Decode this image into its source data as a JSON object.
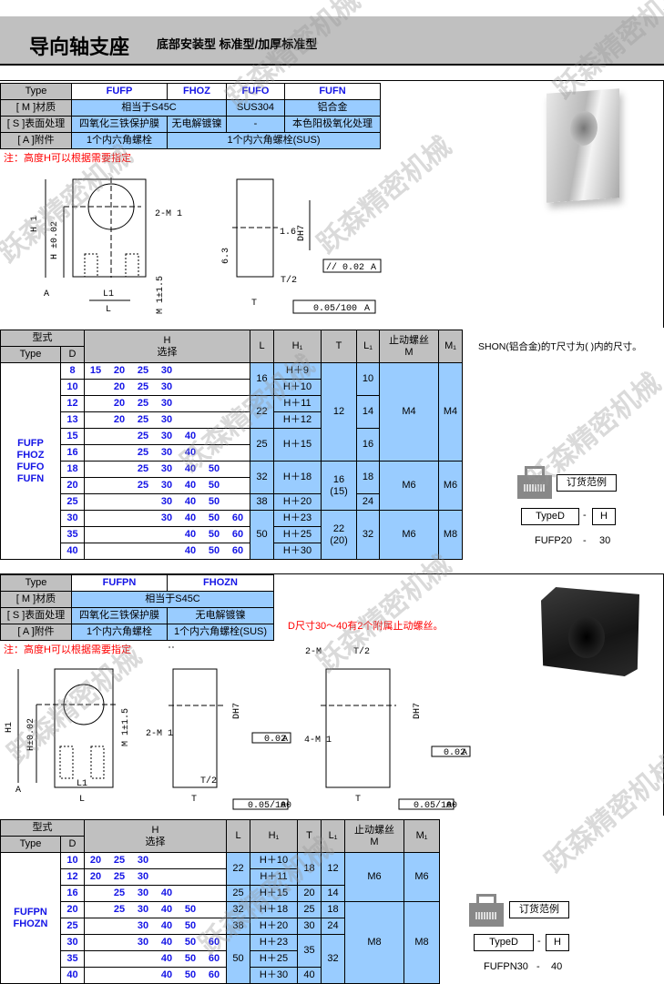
{
  "header": {
    "title": "导向轴支座",
    "subtitle": "底部安装型 标准型/加厚标准型"
  },
  "watermark": "跃森精密机械",
  "colors": {
    "header_gray": "#c0c0c0",
    "cell_blue": "#99ccff",
    "type_text": "#1414e6",
    "note_red": "#ff0000"
  },
  "spec1": {
    "type_label": "Type",
    "types": [
      "FUFP",
      "FHOZ",
      "FUFO",
      "FUFN"
    ],
    "material_label": "[ M ]材质",
    "material": [
      "相当于S45C",
      "SUS304",
      "铝合金"
    ],
    "surface_label": "[ S ]表面处理",
    "surface": [
      "四氧化三铁保护膜",
      "无电解镀镍",
      "-",
      "本色阳极氧化处理"
    ],
    "accessory_label": "[ A ]附件",
    "accessory": [
      "1个内六角螺栓",
      "1个内六角螺栓(SUS)"
    ],
    "note": "注：高度H可以根据需要指定"
  },
  "drawing1": {
    "M": "M",
    "M1": "2-M 1",
    "H1": "H 1",
    "H": "H ±0.02",
    "L1": "L1",
    "L": "L",
    "M1h": "M 1±1.5",
    "DH7": "DH7",
    "r16": "1.6",
    "r63": "6.3",
    "T2": "T/2",
    "T": "T",
    "par1": "0.02",
    "par2": "0.05/100",
    "datum": "A",
    "par_sym": "//"
  },
  "table1": {
    "h_type_cn": "型式",
    "h_type": "Type",
    "h_D": "D",
    "h_H": "H\n选择",
    "h_L": "L",
    "h_H1": "H₁",
    "h_T": "T",
    "h_L1": "L₁",
    "h_M": "止动螺丝\nM",
    "h_M1": "M₁",
    "types": "FUFP\nFHOZ\nFUFO\nFUFN",
    "rows": [
      {
        "D": "8",
        "H": [
          "15",
          "20",
          "25",
          "30",
          "",
          "",
          ""
        ]
      },
      {
        "D": "10",
        "H": [
          "",
          "20",
          "25",
          "30",
          "",
          "",
          ""
        ]
      },
      {
        "D": "12",
        "H": [
          "",
          "20",
          "25",
          "30",
          "",
          "",
          ""
        ]
      },
      {
        "D": "13",
        "H": [
          "",
          "20",
          "25",
          "30",
          "",
          "",
          ""
        ]
      },
      {
        "D": "15",
        "H": [
          "",
          "",
          "25",
          "30",
          "40",
          "",
          ""
        ]
      },
      {
        "D": "16",
        "H": [
          "",
          "",
          "25",
          "30",
          "40",
          "",
          ""
        ]
      },
      {
        "D": "18",
        "H": [
          "",
          "",
          "25",
          "30",
          "40",
          "50",
          ""
        ]
      },
      {
        "D": "20",
        "H": [
          "",
          "",
          "25",
          "30",
          "40",
          "50",
          ""
        ]
      },
      {
        "D": "25",
        "H": [
          "",
          "",
          "",
          "30",
          "40",
          "50",
          ""
        ]
      },
      {
        "D": "30",
        "H": [
          "",
          "",
          "",
          "30",
          "40",
          "50",
          "60"
        ]
      },
      {
        "D": "35",
        "H": [
          "",
          "",
          "",
          "",
          "40",
          "50",
          "60"
        ]
      },
      {
        "D": "40",
        "H": [
          "",
          "",
          "",
          "",
          "40",
          "50",
          "60"
        ]
      }
    ],
    "L": [
      {
        "v": "16",
        "span": 2
      },
      {
        "v": "22",
        "span": 2
      },
      {
        "v": "25",
        "span": 2
      },
      {
        "v": "32",
        "span": 2
      },
      {
        "v": "38",
        "span": 1
      },
      {
        "v": "50",
        "span": 3
      }
    ],
    "H1": [
      {
        "v": "H＋9",
        "span": 1
      },
      {
        "v": "H＋10",
        "span": 1
      },
      {
        "v": "H＋11",
        "span": 1
      },
      {
        "v": "H＋12",
        "span": 1
      },
      {
        "v": "H＋15",
        "span": 2
      },
      {
        "v": "H＋18",
        "span": 2
      },
      {
        "v": "H＋20",
        "span": 1
      },
      {
        "v": "H＋23",
        "span": 1
      },
      {
        "v": "H＋25",
        "span": 1
      },
      {
        "v": "H＋30",
        "span": 1
      }
    ],
    "T": [
      {
        "v": "12",
        "span": 6
      },
      {
        "v": "16\n(15)",
        "span": 3
      },
      {
        "v": "22\n(20)",
        "span": 3
      }
    ],
    "L1": [
      {
        "v": "10",
        "span": 2
      },
      {
        "v": "14",
        "span": 2
      },
      {
        "v": "16",
        "span": 2
      },
      {
        "v": "18",
        "span": 2
      },
      {
        "v": "24",
        "span": 1
      },
      {
        "v": "32",
        "span": 3
      }
    ],
    "M": [
      {
        "v": "M4",
        "span": 6
      },
      {
        "v": "M6",
        "span": 3
      },
      {
        "v": "M6",
        "span": 3
      }
    ],
    "M1": [
      {
        "v": "M4",
        "span": 6
      },
      {
        "v": "M6",
        "span": 3
      },
      {
        "v": "M8",
        "span": 3
      }
    ]
  },
  "side1": {
    "note": "SHON(铝合金)的T尺寸为( )内的尺寸。",
    "order_label": "订货范例",
    "typed": "TypeD",
    "dash": "-",
    "h": "H",
    "example_type": "FUFP20",
    "example_h": "30"
  },
  "spec2": {
    "type_label": "Type",
    "types": [
      "FUFPN",
      "FHOZN"
    ],
    "material_label": "[ M ]材质",
    "material": "相当于S45C",
    "surface_label": "[ S ]表面处理",
    "surface": [
      "四氧化三铁保护膜",
      "无电解镀镍"
    ],
    "accessory_label": "[ A ]附件",
    "accessory": [
      "1个内六角螺栓",
      "1个内六角螺栓(SUS)"
    ],
    "note": "注：高度H可以根据需要指定",
    "d_note": "D尺寸30～40有2个附属止动螺丝。"
  },
  "drawing2": {
    "M": "M",
    "M1": "2-M 1",
    "M2": "2-M",
    "M4": "4-M 1",
    "H1": "H1",
    "H": "H±0.02",
    "L1": "L1",
    "L": "L",
    "M1h": "M 1±1.5",
    "DH7": "DH7",
    "T2": "T/2",
    "T": "T",
    "par1": "0.02",
    "par2": "0.05/100",
    "datum": "A"
  },
  "table2": {
    "h_type_cn": "型式",
    "h_type": "Type",
    "h_D": "D",
    "h_H": "H\n选择",
    "h_L": "L",
    "h_H1": "H₁",
    "h_T": "T",
    "h_L1": "L₁",
    "h_M": "止动螺丝\nM",
    "h_M1": "M₁",
    "types": "FUFPN\nFHOZN",
    "rows": [
      {
        "D": "10",
        "H": [
          "20",
          "25",
          "30",
          "",
          "",
          ""
        ]
      },
      {
        "D": "12",
        "H": [
          "20",
          "25",
          "30",
          "",
          "",
          ""
        ]
      },
      {
        "D": "16",
        "H": [
          "",
          "25",
          "30",
          "40",
          "",
          ""
        ]
      },
      {
        "D": "20",
        "H": [
          "",
          "25",
          "30",
          "40",
          "50",
          ""
        ]
      },
      {
        "D": "25",
        "H": [
          "",
          "",
          "30",
          "40",
          "50",
          ""
        ]
      },
      {
        "D": "30",
        "H": [
          "",
          "",
          "30",
          "40",
          "50",
          "60"
        ]
      },
      {
        "D": "35",
        "H": [
          "",
          "",
          "",
          "40",
          "50",
          "60"
        ]
      },
      {
        "D": "40",
        "H": [
          "",
          "",
          "",
          "40",
          "50",
          "60"
        ]
      }
    ],
    "L": [
      {
        "v": "22",
        "span": 2
      },
      {
        "v": "25",
        "span": 1
      },
      {
        "v": "32",
        "span": 1
      },
      {
        "v": "38",
        "span": 1
      },
      {
        "v": "50",
        "span": 3
      }
    ],
    "H1": [
      {
        "v": "H＋10",
        "span": 1
      },
      {
        "v": "H＋11",
        "span": 1
      },
      {
        "v": "H＋15",
        "span": 1
      },
      {
        "v": "H＋18",
        "span": 1
      },
      {
        "v": "H＋20",
        "span": 1
      },
      {
        "v": "H＋23",
        "span": 1
      },
      {
        "v": "H＋25",
        "span": 1
      },
      {
        "v": "H＋30",
        "span": 1
      }
    ],
    "T": [
      {
        "v": "18",
        "span": 2
      },
      {
        "v": "20",
        "span": 1
      },
      {
        "v": "25",
        "span": 1
      },
      {
        "v": "30",
        "span": 1
      },
      {
        "v": "35",
        "span": 2
      },
      {
        "v": "40",
        "span": 1
      }
    ],
    "L1": [
      {
        "v": "12",
        "span": 2
      },
      {
        "v": "14",
        "span": 1
      },
      {
        "v": "18",
        "span": 1
      },
      {
        "v": "24",
        "span": 1
      },
      {
        "v": "32",
        "span": 3
      }
    ],
    "M": [
      {
        "v": "M6",
        "span": 3
      },
      {
        "v": "M8",
        "span": 5
      }
    ],
    "M1": [
      {
        "v": "M6",
        "span": 3
      },
      {
        "v": "M8",
        "span": 5
      }
    ]
  },
  "side2": {
    "order_label": "订货范例",
    "typed": "TypeD",
    "dash": "-",
    "h": "H",
    "example_type": "FUFPN30",
    "example_h": "40"
  }
}
